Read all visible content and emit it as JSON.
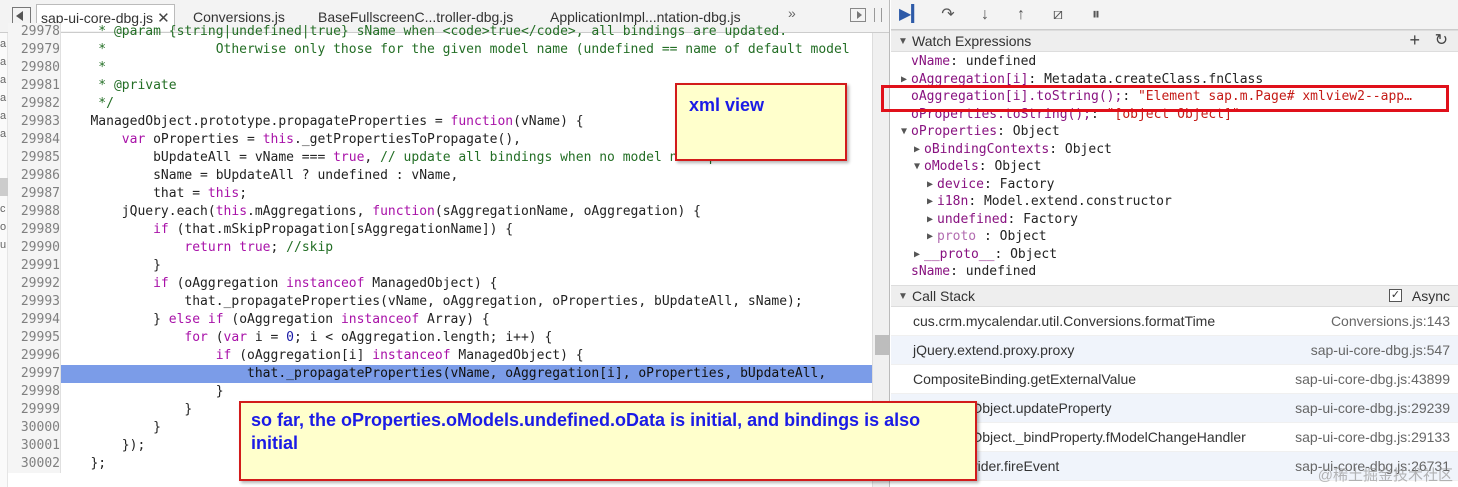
{
  "tabs": [
    {
      "label": "sap-ui-core-dbg.js",
      "active": true
    },
    {
      "label": "Conversions.js"
    },
    {
      "label": "BaseFullscreenC...troller-dbg.js"
    },
    {
      "label": "ApplicationImpl...ntation-dbg.js"
    }
  ],
  "tabs_more": "»",
  "gutter_letters": [
    "a",
    "a",
    "a",
    "a",
    "a",
    "a",
    "c",
    "o",
    "u"
  ],
  "code_lines": [
    {
      "n": "29978",
      "html": "<span class=\"c\">    * @param {string|undefined|true} sName when &lt;code&gt;true&lt;/code&gt;, all bindings are updated.</span>"
    },
    {
      "n": "29979",
      "html": "<span class=\"c\">    *              Otherwise only those for the given model name (undefined == name of default model</span>"
    },
    {
      "n": "29980",
      "html": "<span class=\"c\">    *</span>"
    },
    {
      "n": "29981",
      "html": "<span class=\"c\">    * @private</span>"
    },
    {
      "n": "29982",
      "html": "<span class=\"c\">    */</span>"
    },
    {
      "n": "29983",
      "html": "   ManagedObject.prototype.propagateProperties = <span class=\"k\">function</span>(vName) {"
    },
    {
      "n": "29984",
      "html": "       <span class=\"k\">var</span> oProperties = <span class=\"k\">this</span>._getPropertiesToPropagate(),"
    },
    {
      "n": "29985",
      "html": "           bUpdateAll = vName === <span class=\"k\">true</span>, <span class=\"c\">// update all bindings when no model name parameter has b</span>"
    },
    {
      "n": "29986",
      "html": "           sName = bUpdateAll ? undefined : vName,"
    },
    {
      "n": "29987",
      "html": "           that = <span class=\"k\">this</span>;"
    },
    {
      "n": "29988",
      "html": "       jQuery.each(<span class=\"k\">this</span>.mAggregations, <span class=\"k\">function</span>(sAggregationName, oAggregation) {"
    },
    {
      "n": "29989",
      "html": "           <span class=\"k\">if</span> (that.mSkipPropagation[sAggregationName]) {"
    },
    {
      "n": "29990",
      "html": "               <span class=\"k\">return</span> <span class=\"k\">true</span>; <span class=\"c\">//skip</span>"
    },
    {
      "n": "29991",
      "html": "           }"
    },
    {
      "n": "29992",
      "html": "           <span class=\"k\">if</span> (oAggregation <span class=\"k\">instanceof</span> ManagedObject) {"
    },
    {
      "n": "29993",
      "html": "               that._propagateProperties(vName, oAggregation, oProperties, bUpdateAll, sName);"
    },
    {
      "n": "29994",
      "html": "           } <span class=\"k\">else if</span> (oAggregation <span class=\"k\">instanceof</span> Array) {"
    },
    {
      "n": "29995",
      "html": "               <span class=\"k\">for</span> (<span class=\"k\">var</span> i = <span class=\"s\">0</span>; i &lt; oAggregation.length; i++) {"
    },
    {
      "n": "29996",
      "html": "                   <span class=\"k\">if</span> (oAggregation[i] <span class=\"k\">instanceof</span> ManagedObject) {"
    },
    {
      "n": "29997",
      "html": "                       that._propagateProperties(vName, oAggregation[i], oProperties, bUpdateAll,",
      "hl": true
    },
    {
      "n": "29998",
      "html": "                   }"
    },
    {
      "n": "29999",
      "html": "               }"
    },
    {
      "n": "30000",
      "html": "           }"
    },
    {
      "n": "30001",
      "html": "       });"
    },
    {
      "n": "30002",
      "html": "   };"
    }
  ],
  "toolbar_icons": [
    "resume-icon",
    "step-over-icon",
    "step-into-icon",
    "step-out-icon",
    "deactivate-breakpoints-icon",
    "pause-on-exceptions-icon"
  ],
  "watch": {
    "title": "Watch Expressions",
    "add": "+",
    "refresh": "↻",
    "items": [
      {
        "arrow": "",
        "indent": 0,
        "name": "vName",
        "sep": ": ",
        "value": "undefined"
      },
      {
        "arrow": "▶",
        "indent": 0,
        "name": "oAggregation[i]",
        "sep": ": ",
        "value": "Metadata.createClass.fnClass"
      },
      {
        "arrow": "",
        "indent": 0,
        "name": "oAggregation[i].toString();",
        "sep": ": ",
        "value": "\"Element sap.m.Page#  xmlview2--app…",
        "str": true
      },
      {
        "arrow": "",
        "indent": 0,
        "name": "oProperties.toString();",
        "sep": ": ",
        "value": "\"[object Object]\"",
        "str": true
      },
      {
        "arrow": "▼",
        "indent": 0,
        "name": "oProperties",
        "sep": ": ",
        "value": "Object"
      },
      {
        "arrow": "▶",
        "indent": 1,
        "name": "oBindingContexts",
        "sep": ": ",
        "value": "Object"
      },
      {
        "arrow": "▼",
        "indent": 1,
        "name": "oModels",
        "sep": ": ",
        "value": "Object"
      },
      {
        "arrow": "▶",
        "indent": 2,
        "name": "device",
        "sep": ": ",
        "value": "Factory"
      },
      {
        "arrow": "▶",
        "indent": 2,
        "name": "i18n",
        "sep": ": ",
        "value": "Model.extend.constructor"
      },
      {
        "arrow": "▶",
        "indent": 2,
        "name": "undefined",
        "sep": ": ",
        "value": "Factory"
      },
      {
        "arrow": "▶",
        "indent": 2,
        "name": "  proto  ",
        "sep": ": ",
        "value": "Object",
        "dim": true
      },
      {
        "arrow": "▶",
        "indent": 1,
        "name": "__proto__",
        "sep": ": ",
        "value": "Object"
      },
      {
        "arrow": "",
        "indent": 0,
        "name": "sName",
        "sep": ": ",
        "value": "undefined"
      }
    ]
  },
  "callstack": {
    "title": "Call Stack",
    "async_label": "Async",
    "frames": [
      {
        "fn": "cus.crm.mycalendar.util.Conversions.formatTime",
        "loc": "Conversions.js:143"
      },
      {
        "fn": "jQuery.extend.proxy.proxy",
        "loc": "sap-ui-core-dbg.js:547"
      },
      {
        "fn": "CompositeBinding.getExternalValue",
        "loc": "sap-ui-core-dbg.js:43899"
      },
      {
        "fn": "ManagedObject.updateProperty",
        "loc": "sap-ui-core-dbg.js:29239"
      },
      {
        "fn": "ManagedObject._bindProperty.fModelChangeHandler",
        "loc": "sap-ui-core-dbg.js:29133"
      },
      {
        "fn": "EventProvider.fireEvent",
        "loc": "sap-ui-core-dbg.js:26731"
      }
    ]
  },
  "notes": {
    "xml_view": "xml view",
    "so_far": "so far, the oProperties.oModels.undefined.oData is initial, and bindings is also initial"
  },
  "watermark": "@稀土掘金技术社区"
}
